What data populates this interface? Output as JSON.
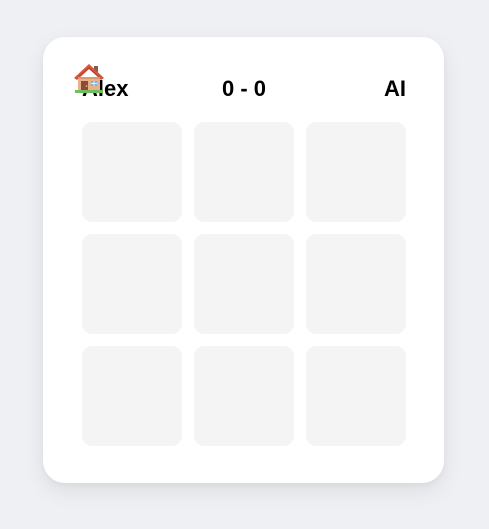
{
  "players": {
    "left_name": "Alex",
    "right_name": "AI"
  },
  "score": {
    "text": "0 - 0"
  },
  "home_button": {
    "icon": "home-icon"
  },
  "board": {
    "cells": [
      "",
      "",
      "",
      "",
      "",
      "",
      "",
      "",
      ""
    ]
  }
}
